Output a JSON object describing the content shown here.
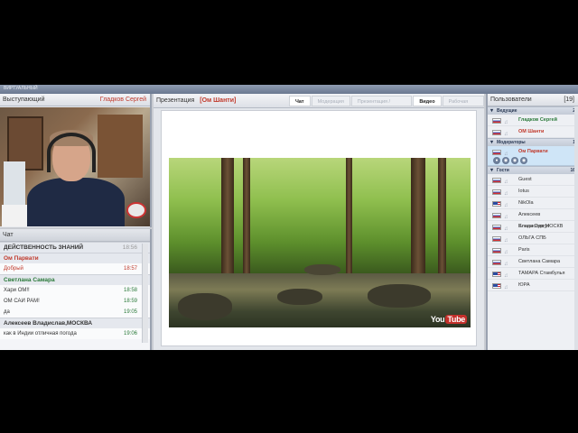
{
  "app": {
    "brand": "ВИРТУАЛЬНЫЙ"
  },
  "speaker": {
    "title": "Выступающий",
    "name": "Гладков Сергей"
  },
  "chat": {
    "title": "Чат",
    "messages": [
      {
        "type": "author",
        "color": "dark",
        "text": "ДЕЙСТВЕННОСТЬ ЗНАНИЙ",
        "time": "18:56"
      },
      {
        "type": "author",
        "color": "red",
        "text": "Ом Парвати",
        "time": ""
      },
      {
        "type": "row",
        "color": "red",
        "text": "Добрый",
        "time": "18:57"
      },
      {
        "type": "author",
        "color": "green",
        "text": "Светлана Самара",
        "time": ""
      },
      {
        "type": "row",
        "color": "",
        "text": "Хари ОМ!!",
        "time": "18:58"
      },
      {
        "type": "row",
        "color": "",
        "text": "ОМ САИ РАМ!",
        "time": "18:59"
      },
      {
        "type": "row",
        "color": "",
        "text": "да",
        "time": "19:05"
      },
      {
        "type": "author",
        "color": "dark",
        "text": "Алексеев Владислав,МОСКВА",
        "time": ""
      },
      {
        "type": "row",
        "color": "",
        "text": "как в Индии отличная погода",
        "time": "19:06"
      }
    ]
  },
  "presentation": {
    "label": "Презентация",
    "name": "[Ом Шанти]",
    "tabs": [
      {
        "label": "Чат",
        "active": true
      },
      {
        "label": "Модерация",
        "active": false
      },
      {
        "label": "Презентация / Документ",
        "active": false
      },
      {
        "label": "Видео",
        "active": true
      },
      {
        "label": "Рабочая доска",
        "active": false
      }
    ],
    "video_logo_a": "You",
    "video_logo_b": "Tube"
  },
  "users": {
    "title": "Пользователи",
    "count": "[19]",
    "groups": [
      {
        "name": "Ведущие",
        "n": "2",
        "members": [
          {
            "name": "Гладков Сергей",
            "flag": "ru",
            "role": "host"
          },
          {
            "name": "ОМ Шанти",
            "flag": "ru",
            "role": "mod"
          }
        ]
      },
      {
        "name": "Модераторы",
        "n": "1",
        "members": [
          {
            "name": "Ом Парвати",
            "flag": "ru",
            "role": "mod"
          }
        ]
      },
      {
        "name": "Гости",
        "n": "16",
        "members": [
          {
            "name": "Guest",
            "flag": "ru",
            "role": ""
          },
          {
            "name": "Iotus",
            "flag": "ru",
            "role": ""
          },
          {
            "name": "NikOla",
            "flag": "us",
            "role": ""
          },
          {
            "name": "Алексеев Владислав,МОСКВ",
            "flag": "ru",
            "role": ""
          },
          {
            "name": "Елена Сургут",
            "flag": "ru",
            "role": ""
          },
          {
            "name": "ОЛЬГА СПБ",
            "flag": "ru",
            "role": ""
          },
          {
            "name": "Paris",
            "flag": "ru",
            "role": ""
          },
          {
            "name": "Светлана Самара",
            "flag": "ru",
            "role": ""
          },
          {
            "name": "ТАМАРА Стамбулья",
            "flag": "us",
            "role": ""
          },
          {
            "name": "ЮРА",
            "flag": "us",
            "role": ""
          }
        ]
      }
    ]
  }
}
